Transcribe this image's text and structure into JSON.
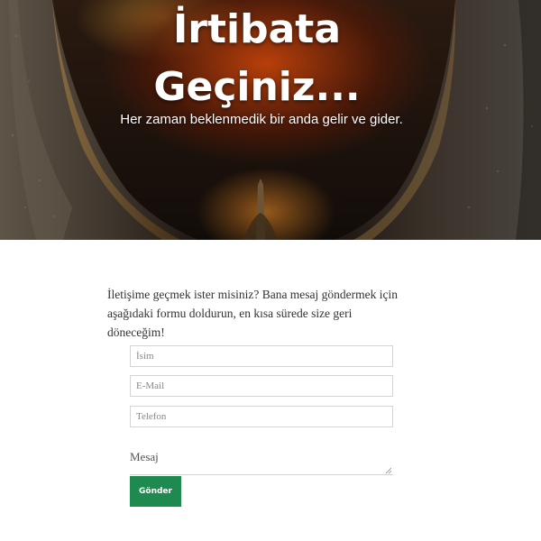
{
  "hero": {
    "title_line1": "İrtibata",
    "title_line2": "Geçiniz...",
    "subtitle": "Her zaman beklenmedik bir anda gelir ve gider."
  },
  "intro": {
    "text": "İletişime geçmek ister misiniz? Bana mesaj göndermek için aşağıdaki formu doldurun, en kısa sürede size geri döneceğim!"
  },
  "form": {
    "name_placeholder": "İsim",
    "email_placeholder": "E-Mail",
    "phone_placeholder": "Telefon",
    "message_label": "Mesaj",
    "submit_label": "Gönder"
  },
  "colors": {
    "accent": "#1f8a4f"
  }
}
